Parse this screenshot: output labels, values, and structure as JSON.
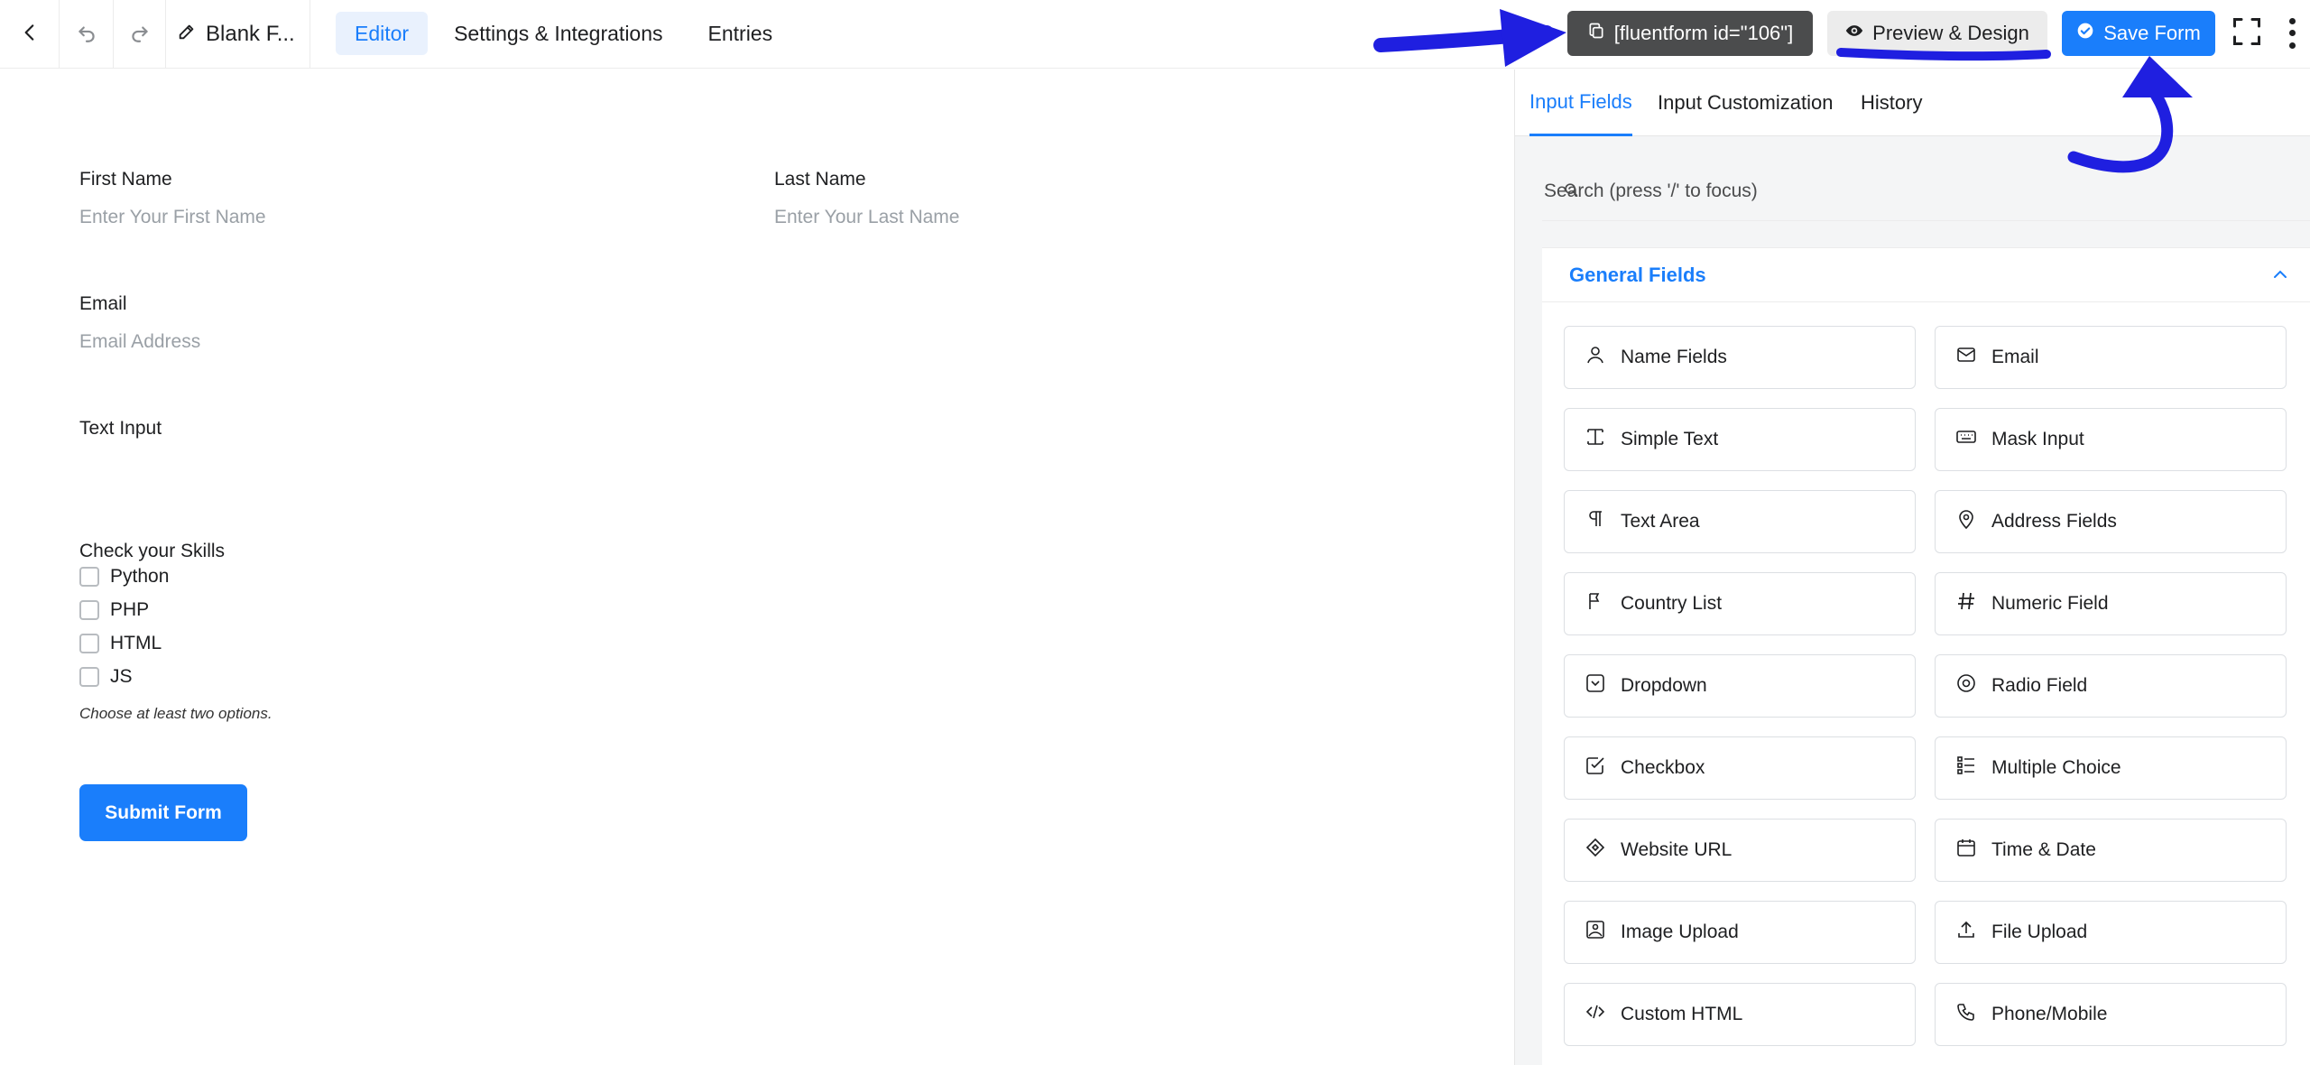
{
  "topbar": {
    "form_title": "Blank F...",
    "nav": [
      "Editor",
      "Settings & Integrations",
      "Entries"
    ],
    "shortcode_label": "[fluentform id=\"106\"]",
    "preview_label": "Preview & Design",
    "save_label": "Save Form"
  },
  "form": {
    "first_name": {
      "label": "First Name",
      "placeholder": "Enter Your First Name"
    },
    "last_name": {
      "label": "Last Name",
      "placeholder": "Enter Your Last Name"
    },
    "email": {
      "label": "Email",
      "placeholder": "Email Address"
    },
    "text_input": {
      "label": "Text Input"
    },
    "skills": {
      "label": "Check your Skills",
      "options": [
        "Python",
        "PHP",
        "HTML",
        "JS"
      ],
      "help": "Choose at least two options."
    },
    "submit_label": "Submit Form"
  },
  "sidebar": {
    "tabs": [
      "Input Fields",
      "Input Customization",
      "History"
    ],
    "search_placeholder": "Search (press '/' to focus)",
    "section_title": "General Fields",
    "fields": [
      {
        "label": "Name Fields",
        "icon": "person-icon"
      },
      {
        "label": "Email",
        "icon": "envelope-icon"
      },
      {
        "label": "Simple Text",
        "icon": "text-cursor-icon"
      },
      {
        "label": "Mask Input",
        "icon": "keyboard-icon"
      },
      {
        "label": "Text Area",
        "icon": "paragraph-icon"
      },
      {
        "label": "Address Fields",
        "icon": "map-pin-icon"
      },
      {
        "label": "Country List",
        "icon": "flag-icon"
      },
      {
        "label": "Numeric Field",
        "icon": "hash-icon"
      },
      {
        "label": "Dropdown",
        "icon": "dropdown-icon"
      },
      {
        "label": "Radio Field",
        "icon": "radio-icon"
      },
      {
        "label": "Checkbox",
        "icon": "checkbox-icon"
      },
      {
        "label": "Multiple Choice",
        "icon": "list-icon"
      },
      {
        "label": "Website URL",
        "icon": "link-icon"
      },
      {
        "label": "Time & Date",
        "icon": "calendar-icon"
      },
      {
        "label": "Image Upload",
        "icon": "image-icon"
      },
      {
        "label": "File Upload",
        "icon": "upload-icon"
      },
      {
        "label": "Custom HTML",
        "icon": "code-icon"
      },
      {
        "label": "Phone/Mobile",
        "icon": "phone-icon"
      }
    ]
  },
  "colors": {
    "accent": "#1a7efb",
    "annotation": "#1f1fe0",
    "shortcode_bg": "#4b4c4d"
  }
}
